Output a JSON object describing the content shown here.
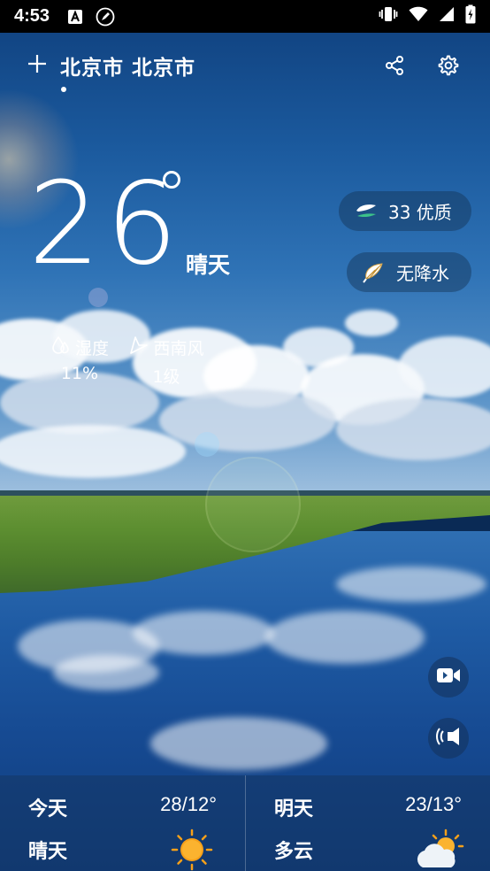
{
  "status_bar": {
    "time": "4:53",
    "icons": [
      "a-notification-icon",
      "rocket-icon",
      "vibrate-icon",
      "wifi-icon",
      "signal-icon",
      "battery-charging-icon"
    ]
  },
  "header": {
    "location": "北京市 北京市",
    "add_icon": "plus-icon",
    "share_icon": "share-icon",
    "settings_icon": "gear-icon"
  },
  "current": {
    "temperature": "26",
    "condition": "晴天",
    "aqi_label": "33 优质",
    "precip_label": "无降水",
    "humidity_label": "湿度",
    "humidity_value": "11%",
    "wind_label": "西南风",
    "wind_value": "1级"
  },
  "forecast": [
    {
      "day": "今天",
      "temp": "28/12°",
      "condition": "晴天",
      "icon": "sun-icon"
    },
    {
      "day": "明天",
      "temp": "23/13°",
      "condition": "多云",
      "icon": "partly-cloudy-icon"
    }
  ],
  "fabs": {
    "video_icon": "video-icon",
    "audio_icon": "speaker-icon"
  },
  "colors": {
    "accent_green": "#3cc28a",
    "sun_orange": "#f6a01a"
  }
}
